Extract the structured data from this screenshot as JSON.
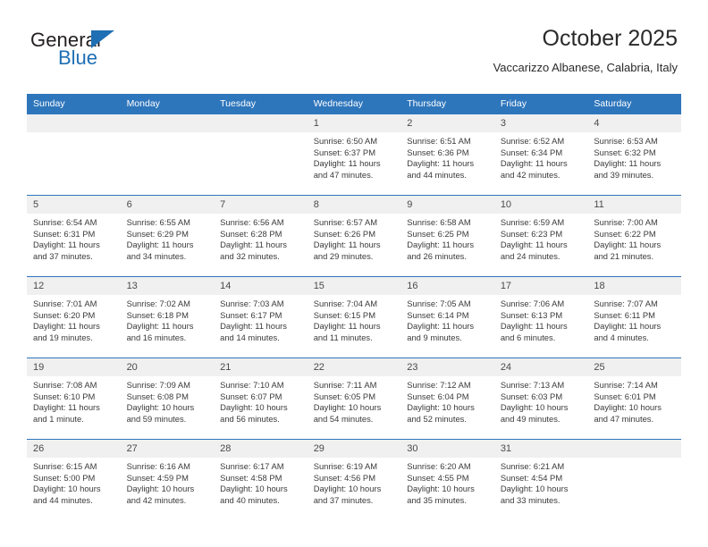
{
  "brand": {
    "name_top": "General",
    "name_bottom": "Blue",
    "accent_color": "#1f6fb4"
  },
  "header": {
    "title": "October 2025",
    "subtitle": "Vaccarizzo Albanese, Calabria, Italy"
  },
  "theme": {
    "header_bg": "#2e76bc",
    "daynum_bg": "#f0f0f0",
    "grid_line": "#2e76bc"
  },
  "weekday_headers": [
    "Sunday",
    "Monday",
    "Tuesday",
    "Wednesday",
    "Thursday",
    "Friday",
    "Saturday"
  ],
  "labels": {
    "sunrise": "Sunrise:",
    "sunset": "Sunset:",
    "daylight": "Daylight:"
  },
  "weeks": [
    [
      {
        "day": "",
        "blank": true
      },
      {
        "day": "",
        "blank": true
      },
      {
        "day": "",
        "blank": true
      },
      {
        "day": "1",
        "sunrise": "Sunrise: 6:50 AM",
        "sunset": "Sunset: 6:37 PM",
        "daylight": "Daylight: 11 hours and 47 minutes."
      },
      {
        "day": "2",
        "sunrise": "Sunrise: 6:51 AM",
        "sunset": "Sunset: 6:36 PM",
        "daylight": "Daylight: 11 hours and 44 minutes."
      },
      {
        "day": "3",
        "sunrise": "Sunrise: 6:52 AM",
        "sunset": "Sunset: 6:34 PM",
        "daylight": "Daylight: 11 hours and 42 minutes."
      },
      {
        "day": "4",
        "sunrise": "Sunrise: 6:53 AM",
        "sunset": "Sunset: 6:32 PM",
        "daylight": "Daylight: 11 hours and 39 minutes."
      }
    ],
    [
      {
        "day": "5",
        "sunrise": "Sunrise: 6:54 AM",
        "sunset": "Sunset: 6:31 PM",
        "daylight": "Daylight: 11 hours and 37 minutes."
      },
      {
        "day": "6",
        "sunrise": "Sunrise: 6:55 AM",
        "sunset": "Sunset: 6:29 PM",
        "daylight": "Daylight: 11 hours and 34 minutes."
      },
      {
        "day": "7",
        "sunrise": "Sunrise: 6:56 AM",
        "sunset": "Sunset: 6:28 PM",
        "daylight": "Daylight: 11 hours and 32 minutes."
      },
      {
        "day": "8",
        "sunrise": "Sunrise: 6:57 AM",
        "sunset": "Sunset: 6:26 PM",
        "daylight": "Daylight: 11 hours and 29 minutes."
      },
      {
        "day": "9",
        "sunrise": "Sunrise: 6:58 AM",
        "sunset": "Sunset: 6:25 PM",
        "daylight": "Daylight: 11 hours and 26 minutes."
      },
      {
        "day": "10",
        "sunrise": "Sunrise: 6:59 AM",
        "sunset": "Sunset: 6:23 PM",
        "daylight": "Daylight: 11 hours and 24 minutes."
      },
      {
        "day": "11",
        "sunrise": "Sunrise: 7:00 AM",
        "sunset": "Sunset: 6:22 PM",
        "daylight": "Daylight: 11 hours and 21 minutes."
      }
    ],
    [
      {
        "day": "12",
        "sunrise": "Sunrise: 7:01 AM",
        "sunset": "Sunset: 6:20 PM",
        "daylight": "Daylight: 11 hours and 19 minutes."
      },
      {
        "day": "13",
        "sunrise": "Sunrise: 7:02 AM",
        "sunset": "Sunset: 6:18 PM",
        "daylight": "Daylight: 11 hours and 16 minutes."
      },
      {
        "day": "14",
        "sunrise": "Sunrise: 7:03 AM",
        "sunset": "Sunset: 6:17 PM",
        "daylight": "Daylight: 11 hours and 14 minutes."
      },
      {
        "day": "15",
        "sunrise": "Sunrise: 7:04 AM",
        "sunset": "Sunset: 6:15 PM",
        "daylight": "Daylight: 11 hours and 11 minutes."
      },
      {
        "day": "16",
        "sunrise": "Sunrise: 7:05 AM",
        "sunset": "Sunset: 6:14 PM",
        "daylight": "Daylight: 11 hours and 9 minutes."
      },
      {
        "day": "17",
        "sunrise": "Sunrise: 7:06 AM",
        "sunset": "Sunset: 6:13 PM",
        "daylight": "Daylight: 11 hours and 6 minutes."
      },
      {
        "day": "18",
        "sunrise": "Sunrise: 7:07 AM",
        "sunset": "Sunset: 6:11 PM",
        "daylight": "Daylight: 11 hours and 4 minutes."
      }
    ],
    [
      {
        "day": "19",
        "sunrise": "Sunrise: 7:08 AM",
        "sunset": "Sunset: 6:10 PM",
        "daylight": "Daylight: 11 hours and 1 minute."
      },
      {
        "day": "20",
        "sunrise": "Sunrise: 7:09 AM",
        "sunset": "Sunset: 6:08 PM",
        "daylight": "Daylight: 10 hours and 59 minutes."
      },
      {
        "day": "21",
        "sunrise": "Sunrise: 7:10 AM",
        "sunset": "Sunset: 6:07 PM",
        "daylight": "Daylight: 10 hours and 56 minutes."
      },
      {
        "day": "22",
        "sunrise": "Sunrise: 7:11 AM",
        "sunset": "Sunset: 6:05 PM",
        "daylight": "Daylight: 10 hours and 54 minutes."
      },
      {
        "day": "23",
        "sunrise": "Sunrise: 7:12 AM",
        "sunset": "Sunset: 6:04 PM",
        "daylight": "Daylight: 10 hours and 52 minutes."
      },
      {
        "day": "24",
        "sunrise": "Sunrise: 7:13 AM",
        "sunset": "Sunset: 6:03 PM",
        "daylight": "Daylight: 10 hours and 49 minutes."
      },
      {
        "day": "25",
        "sunrise": "Sunrise: 7:14 AM",
        "sunset": "Sunset: 6:01 PM",
        "daylight": "Daylight: 10 hours and 47 minutes."
      }
    ],
    [
      {
        "day": "26",
        "sunrise": "Sunrise: 6:15 AM",
        "sunset": "Sunset: 5:00 PM",
        "daylight": "Daylight: 10 hours and 44 minutes."
      },
      {
        "day": "27",
        "sunrise": "Sunrise: 6:16 AM",
        "sunset": "Sunset: 4:59 PM",
        "daylight": "Daylight: 10 hours and 42 minutes."
      },
      {
        "day": "28",
        "sunrise": "Sunrise: 6:17 AM",
        "sunset": "Sunset: 4:58 PM",
        "daylight": "Daylight: 10 hours and 40 minutes."
      },
      {
        "day": "29",
        "sunrise": "Sunrise: 6:19 AM",
        "sunset": "Sunset: 4:56 PM",
        "daylight": "Daylight: 10 hours and 37 minutes."
      },
      {
        "day": "30",
        "sunrise": "Sunrise: 6:20 AM",
        "sunset": "Sunset: 4:55 PM",
        "daylight": "Daylight: 10 hours and 35 minutes."
      },
      {
        "day": "31",
        "sunrise": "Sunrise: 6:21 AM",
        "sunset": "Sunset: 4:54 PM",
        "daylight": "Daylight: 10 hours and 33 minutes."
      },
      {
        "day": "",
        "blank": true
      }
    ]
  ]
}
